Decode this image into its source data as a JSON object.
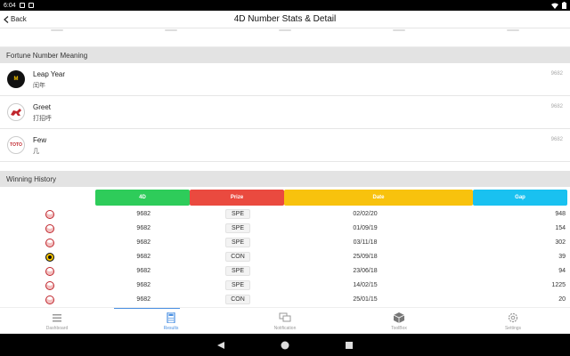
{
  "status_bar": {
    "time": "6:04"
  },
  "appbar": {
    "back_label": "Back",
    "title": "4D Number Stats & Detail"
  },
  "fortune": {
    "header": "Fortune Number Meaning",
    "items": [
      {
        "name": "Leap Year",
        "cn": "闰年",
        "number": "9682",
        "logo": "magnum"
      },
      {
        "name": "Greet",
        "cn": "打招呼",
        "number": "9682",
        "logo": "damacai"
      },
      {
        "name": "Few",
        "cn": "几",
        "number": "9682",
        "logo": "toto"
      }
    ]
  },
  "history": {
    "header": "Winning History",
    "columns": [
      "4D",
      "Prize",
      "Date",
      "Gap"
    ],
    "column_colors": [
      "#2ecc5a",
      "#ea4a3f",
      "#f8c20d",
      "#19c1f0"
    ],
    "rows": [
      {
        "logo": "toto",
        "number": "9682",
        "prize": "SPE",
        "date": "02/02/20",
        "gap": "948"
      },
      {
        "logo": "toto",
        "number": "9682",
        "prize": "SPE",
        "date": "01/09/19",
        "gap": "154"
      },
      {
        "logo": "toto",
        "number": "9682",
        "prize": "SPE",
        "date": "03/11/18",
        "gap": "302"
      },
      {
        "logo": "magnum",
        "number": "9682",
        "prize": "CON",
        "date": "25/09/18",
        "gap": "39"
      },
      {
        "logo": "toto",
        "number": "9682",
        "prize": "SPE",
        "date": "23/06/18",
        "gap": "94"
      },
      {
        "logo": "toto",
        "number": "9682",
        "prize": "SPE",
        "date": "14/02/15",
        "gap": "1225"
      },
      {
        "logo": "damacai",
        "number": "9682",
        "prize": "CON",
        "date": "25/01/15",
        "gap": "20"
      }
    ]
  },
  "bottom_nav": [
    {
      "label": "Dashboard",
      "icon": "list-icon",
      "active": false
    },
    {
      "label": "Results",
      "icon": "calculator-icon",
      "active": true
    },
    {
      "label": "Notification",
      "icon": "chat-icon",
      "active": false
    },
    {
      "label": "ToolBox",
      "icon": "box-icon",
      "active": false
    },
    {
      "label": "Settings",
      "icon": "gear-icon",
      "active": false
    }
  ],
  "colors": {
    "active_nav": "#4a90e2",
    "section_bg": "#e3e3e3"
  }
}
